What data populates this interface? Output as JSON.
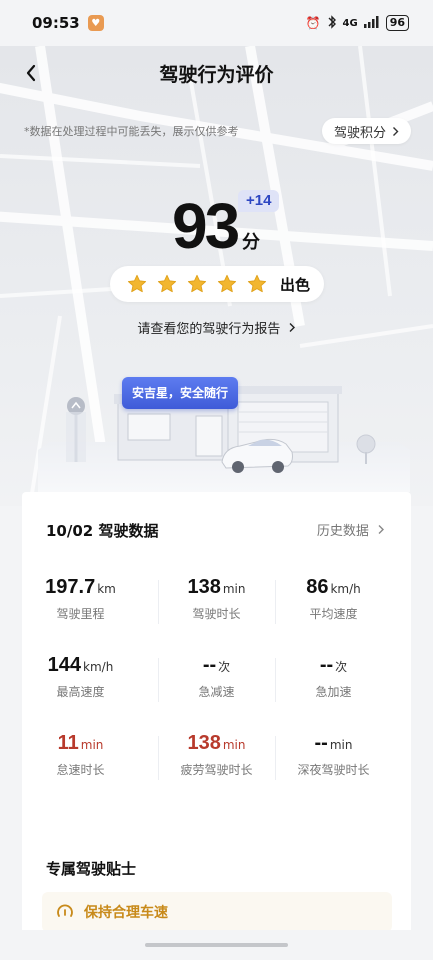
{
  "status_bar": {
    "time": "09:53",
    "network": "4G",
    "battery": "96",
    "icons": [
      "app-heart-icon",
      "alarm-icon",
      "bluetooth-icon",
      "signal-icon",
      "battery-icon"
    ]
  },
  "nav": {
    "title": "驾驶行为评价",
    "back_icon": "chevron-left-icon"
  },
  "disclaimer": "*数据在处理过程中可能丢失，展示仅供参考",
  "score_points_button": "驾驶积分",
  "score": {
    "value": "93",
    "unit": "分",
    "delta": "+14",
    "stars": 5,
    "rating": "出色"
  },
  "report_link": "请查看您的驾驶行为报告",
  "scene": {
    "banner": "安吉星，安全随行"
  },
  "driving_data": {
    "date_title": "10/02 驾驶数据",
    "history_link": "历史数据",
    "metrics": [
      {
        "value": "197.7",
        "unit": "km",
        "label": "驾驶里程",
        "alert": false
      },
      {
        "value": "138",
        "unit": "min",
        "label": "驾驶时长",
        "alert": false
      },
      {
        "value": "86",
        "unit": "km/h",
        "label": "平均速度",
        "alert": false
      },
      {
        "value": "144",
        "unit": "km/h",
        "label": "最高速度",
        "alert": false
      },
      {
        "value": "--",
        "unit": "次",
        "label": "急减速",
        "alert": false
      },
      {
        "value": "--",
        "unit": "次",
        "label": "急加速",
        "alert": false
      },
      {
        "value": "11",
        "unit": "min",
        "label": "怠速时长",
        "alert": true
      },
      {
        "value": "138",
        "unit": "min",
        "label": "疲劳驾驶时长",
        "alert": true
      },
      {
        "value": "--",
        "unit": "min",
        "label": "深夜驾驶时长",
        "alert": false
      }
    ]
  },
  "tips": {
    "title": "专属驾驶贴士",
    "items": [
      {
        "icon": "speedometer-icon",
        "label": "保持合理车速"
      }
    ]
  },
  "colors": {
    "accent_blue": "#3f5bd8",
    "alert_red": "#b83a2c",
    "star_gold": "#f2b630",
    "tip_text": "#c88a1a"
  }
}
